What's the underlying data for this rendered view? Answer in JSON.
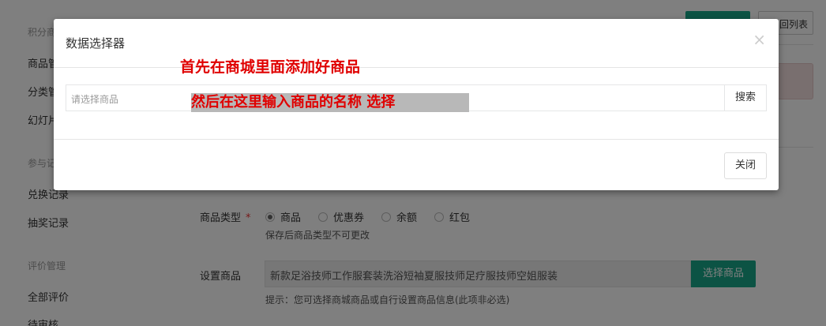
{
  "sidebar": {
    "sections": [
      {
        "label": "积分商"
      },
      {
        "label": "参与记"
      },
      {
        "label": "评价管理"
      }
    ],
    "items": [
      {
        "label": "商品管"
      },
      {
        "label": "分类管"
      },
      {
        "label": "幻灯片"
      },
      {
        "label": "兑换记录"
      },
      {
        "label": "抽奖记录"
      },
      {
        "label": "全部评价"
      },
      {
        "label": "待审核"
      }
    ]
  },
  "header": {
    "back_label": "回列表"
  },
  "form": {
    "goods_type_label": "商品类型",
    "required_mark": "*",
    "radio_options": [
      {
        "label": "商品",
        "checked": true
      },
      {
        "label": "优惠券",
        "checked": false
      },
      {
        "label": "余额",
        "checked": false
      },
      {
        "label": "红包",
        "checked": false
      }
    ],
    "type_hint": "保存后商品类型不可更改",
    "set_goods_label": "设置商品",
    "goods_value": "新款足浴技师工作服套装洗浴短袖夏服技师足疗服技师空姐服装",
    "select_goods_button": "选择商品",
    "goods_hint": "提示：您可选择商城商品或自行设置商品信息(此项非必选)"
  },
  "modal": {
    "title": "数据选择器",
    "close_symbol": "×",
    "search_placeholder": "请选择商品",
    "search_button": "搜索",
    "close_button": "关闭"
  },
  "annotations": {
    "first": "首先在商城里面添加好商品",
    "second": "然后在这里输入商品的名称 选择"
  },
  "colors": {
    "accent": "#18a689",
    "annotation": "#e00000",
    "required": "#e33333"
  }
}
